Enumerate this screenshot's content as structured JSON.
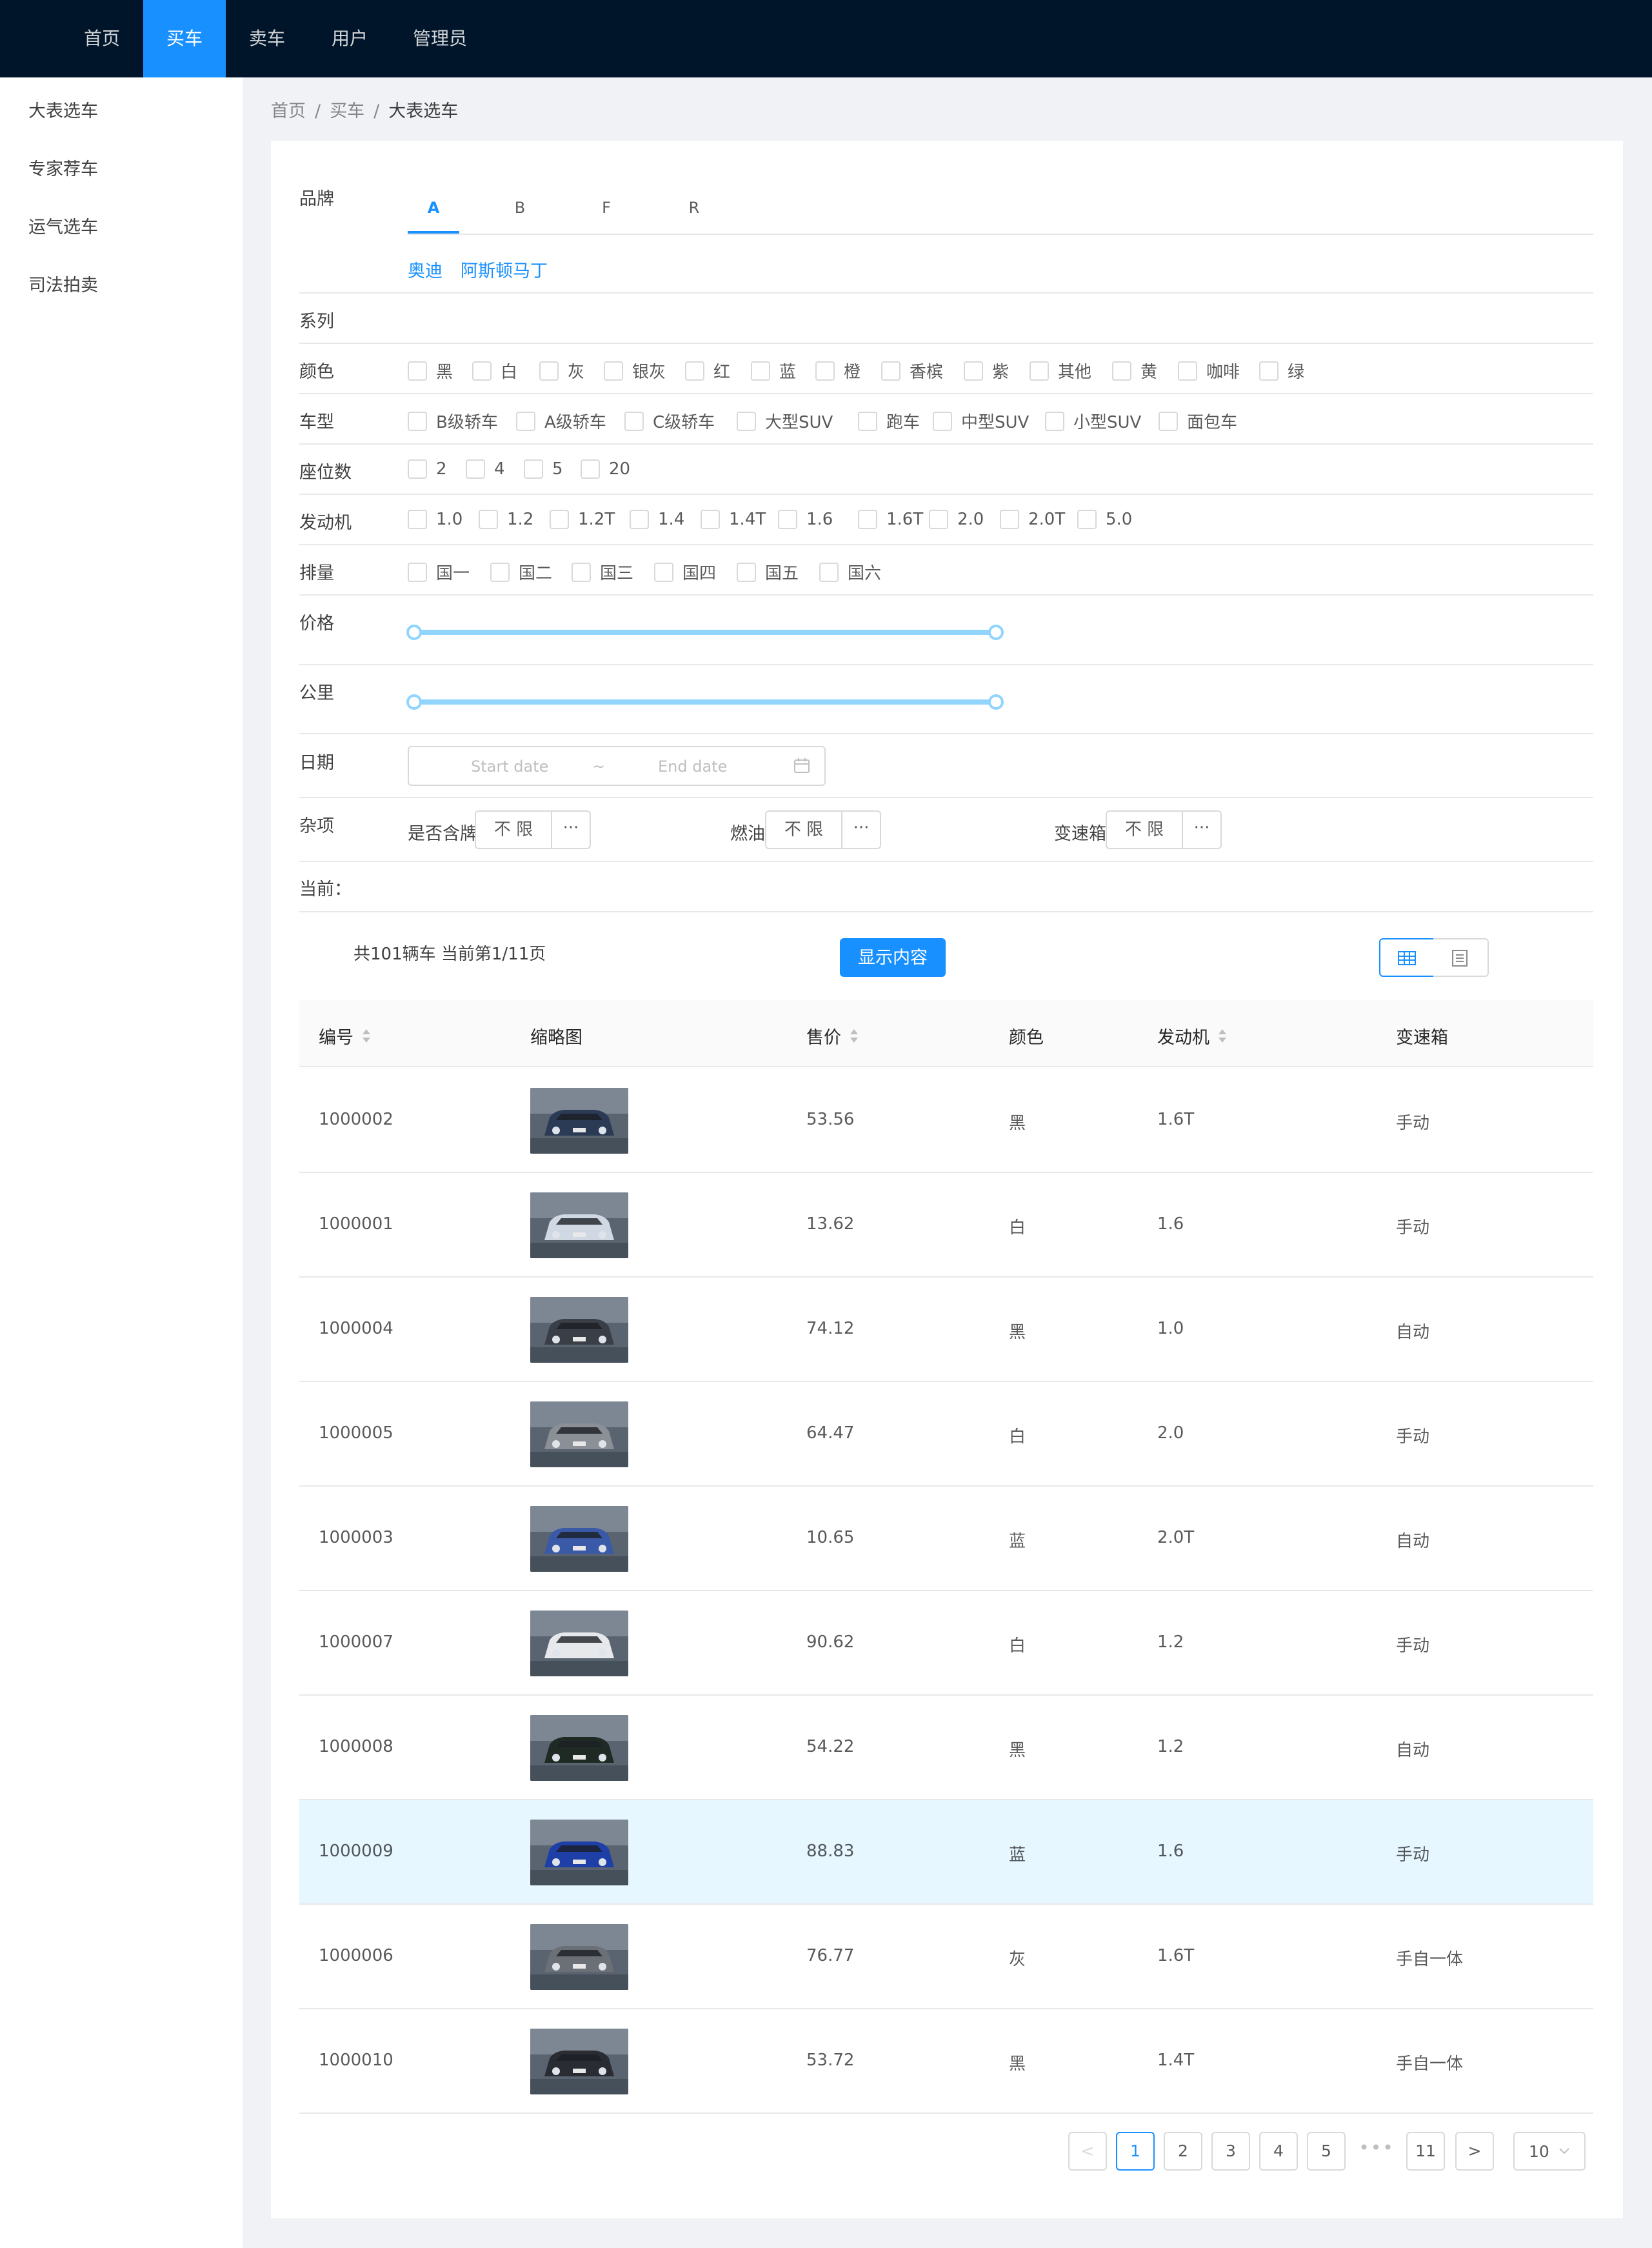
{
  "nav": {
    "items": [
      "首页",
      "买车",
      "卖车",
      "用户",
      "管理员"
    ],
    "active": "买车"
  },
  "sidebar": {
    "items": [
      "大表选车",
      "专家荐车",
      "运气选车",
      "司法拍卖"
    ]
  },
  "breadcrumb": [
    "首页",
    "买车",
    "大表选车"
  ],
  "filters": {
    "brand": {
      "label": "品牌",
      "tabs": [
        "A",
        "B",
        "F",
        "R"
      ],
      "active_tab": "A",
      "brands": [
        "奥迪",
        "阿斯顿马丁"
      ]
    },
    "series": {
      "label": "系列"
    },
    "color": {
      "label": "颜色",
      "options": [
        "黑",
        "白",
        "灰",
        "银灰",
        "红",
        "蓝",
        "橙",
        "香槟",
        "紫",
        "其他",
        "黄",
        "咖啡",
        "绿"
      ]
    },
    "body": {
      "label": "车型",
      "options": [
        "B级轿车",
        "A级轿车",
        "C级轿车",
        "大型SUV",
        "跑车",
        "中型SUV",
        "小型SUV",
        "面包车"
      ]
    },
    "seats": {
      "label": "座位数",
      "options": [
        "2",
        "4",
        "5",
        "20"
      ]
    },
    "engine": {
      "label": "发动机",
      "options": [
        "1.0",
        "1.2",
        "1.2T",
        "1.4",
        "1.4T",
        "1.6",
        "1.6T",
        "2.0",
        "2.0T",
        "5.0"
      ]
    },
    "emission": {
      "label": "排量",
      "options": [
        "国一",
        "国二",
        "国三",
        "国四",
        "国五",
        "国六"
      ]
    },
    "price": {
      "label": "价格",
      "range_fraction": [
        0,
        1
      ]
    },
    "mileage": {
      "label": "公里",
      "range_fraction": [
        0,
        1
      ]
    },
    "date": {
      "label": "日期",
      "start_placeholder": "Start date",
      "separator": "~",
      "end_placeholder": "End date",
      "icon": "calendar-icon"
    },
    "misc": {
      "label": "杂项",
      "groups": [
        {
          "label": "是否含牌",
          "value": "不 限",
          "more": "···"
        },
        {
          "label": "燃油",
          "value": "不 限",
          "more": "···"
        },
        {
          "label": "变速箱",
          "value": "不 限",
          "more": "···"
        }
      ]
    },
    "current": {
      "label": "当前："
    }
  },
  "summary": {
    "text": "共101辆车 当前第1/11页",
    "show_button": "显示内容",
    "view_modes": [
      "table-icon",
      "list-icon"
    ],
    "active_view": "table-icon"
  },
  "table": {
    "columns": [
      "编号",
      "缩略图",
      "售价",
      "颜色",
      "发动机",
      "变速箱"
    ],
    "sortable": [
      "编号",
      "售价",
      "发动机"
    ],
    "rows": [
      {
        "id": "1000002",
        "price": "53.56",
        "color": "黑",
        "engine": "1.6T",
        "gearbox": "手动"
      },
      {
        "id": "1000001",
        "price": "13.62",
        "color": "白",
        "engine": "1.6",
        "gearbox": "手动"
      },
      {
        "id": "1000004",
        "price": "74.12",
        "color": "黑",
        "engine": "1.0",
        "gearbox": "自动"
      },
      {
        "id": "1000005",
        "price": "64.47",
        "color": "白",
        "engine": "2.0",
        "gearbox": "手动"
      },
      {
        "id": "1000003",
        "price": "10.65",
        "color": "蓝",
        "engine": "2.0T",
        "gearbox": "自动"
      },
      {
        "id": "1000007",
        "price": "90.62",
        "color": "白",
        "engine": "1.2",
        "gearbox": "手动"
      },
      {
        "id": "1000008",
        "price": "54.22",
        "color": "黑",
        "engine": "1.2",
        "gearbox": "自动"
      },
      {
        "id": "1000009",
        "price": "88.83",
        "color": "蓝",
        "engine": "1.6",
        "gearbox": "手动"
      },
      {
        "id": "1000006",
        "price": "76.77",
        "color": "灰",
        "engine": "1.6T",
        "gearbox": "手自一体"
      },
      {
        "id": "1000010",
        "price": "53.72",
        "color": "黑",
        "engine": "1.4T",
        "gearbox": "手自一体"
      }
    ],
    "highlighted_row": "1000009"
  },
  "pagination": {
    "prev": "<",
    "pages": [
      "1",
      "2",
      "3",
      "4",
      "5"
    ],
    "ellipsis": "•••",
    "last": "11",
    "next": ">",
    "current": "1",
    "page_size": "10"
  },
  "colors": {
    "header_bg": "#001529",
    "primary": "#1890ff",
    "slider": "#91d5ff",
    "row_highlight": "#e6f7ff",
    "page_bg": "#f0f2f5"
  }
}
